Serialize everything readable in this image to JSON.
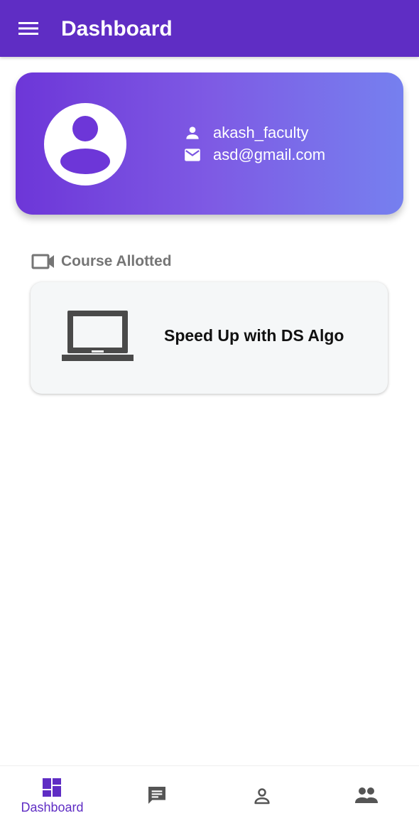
{
  "appbar": {
    "title": "Dashboard",
    "menu_icon": "hamburger-menu-icon",
    "background": "#5f2dc4"
  },
  "profile": {
    "username": "akash_faculty",
    "email": "asd@gmail.com",
    "user_icon": "person-icon",
    "email_icon": "mail-icon",
    "gradient": [
      "#6d36d8",
      "#7680ef"
    ]
  },
  "section": {
    "title": "Course Allotted",
    "icon": "videocam-icon"
  },
  "courses": [
    {
      "name": "Speed Up with DS Algo",
      "icon": "laptop-icon"
    }
  ],
  "bottom_nav": {
    "active_color": "#5f2dc4",
    "inactive_color": "#555555",
    "items": [
      {
        "label": "Dashboard",
        "icon": "dashboard-icon",
        "active": true
      },
      {
        "icon": "chat-icon",
        "active": false
      },
      {
        "icon": "person-outline-icon",
        "active": false
      },
      {
        "icon": "people-icon",
        "active": false
      }
    ]
  }
}
